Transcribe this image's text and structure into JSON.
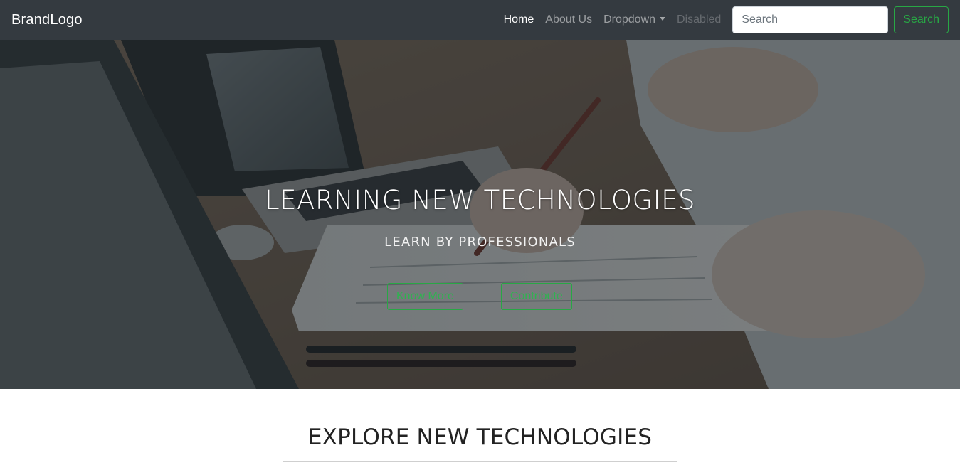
{
  "navbar": {
    "brand": "BrandLogo",
    "links": [
      {
        "label": "Home",
        "state": "active"
      },
      {
        "label": "About Us",
        "state": "normal"
      },
      {
        "label": "Dropdown",
        "state": "dropdown"
      },
      {
        "label": "Disabled",
        "state": "disabled"
      }
    ],
    "search": {
      "placeholder": "Search",
      "value": "",
      "button_label": "Search"
    },
    "background_color": "#343a40",
    "accent_color": "#28a745"
  },
  "hero": {
    "title": "LEARNING NEW TECHNOLOGIES",
    "subtitle": "LEARN BY PROFESSIONALS",
    "buttons": [
      {
        "label": "Know More"
      },
      {
        "label": "Contribute"
      }
    ]
  },
  "explore": {
    "title": "EXPLORE NEW TECHNOLOGIES"
  },
  "icons": {
    "dropdown": "caret-down-icon"
  }
}
